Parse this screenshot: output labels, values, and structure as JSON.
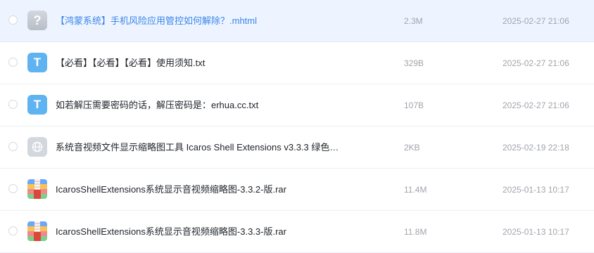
{
  "files": [
    {
      "name": "【鸿蒙系统】手机风险应用管控如何解除？.mhtml",
      "size": "2.3M",
      "date": "2025-02-27 21:06",
      "icon": "unknown-file-icon",
      "glyph": "?",
      "selected_highlight": true
    },
    {
      "name": "【必看】【必看】【必看】使用须知.txt",
      "size": "329B",
      "date": "2025-02-27 21:06",
      "icon": "text-file-icon",
      "glyph": "T"
    },
    {
      "name": "如若解压需要密码的话，解压密码是：erhua.cc.txt",
      "size": "107B",
      "date": "2025-02-27 21:06",
      "icon": "text-file-icon",
      "glyph": "T"
    },
    {
      "name": "系统音视频文件显示缩略图工具 Icaros Shell Extensions v3.3.3 绿色…",
      "size": "2KB",
      "date": "2025-02-19 22:18",
      "icon": "web-link-icon"
    },
    {
      "name": "IcarosShellExtensions系统显示音视频缩略图-3.3.2-版.rar",
      "size": "11.4M",
      "date": "2025-01-13 10:17",
      "icon": "archive-file-icon"
    },
    {
      "name": "IcarosShellExtensions系统显示音视频缩略图-3.3.3-版.rar",
      "size": "11.8M",
      "date": "2025-01-13 10:17",
      "icon": "archive-file-icon"
    }
  ],
  "colors": {
    "highlight_row": "#eef4ff",
    "highlight_text": "#3a86e8",
    "txt_icon": "#5fb3f0",
    "muted_text": "#a0a4ab"
  }
}
